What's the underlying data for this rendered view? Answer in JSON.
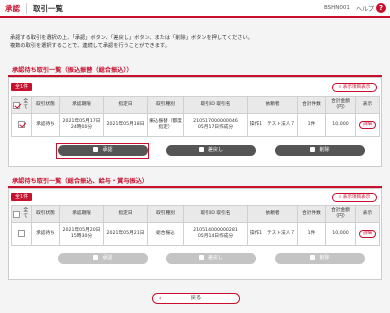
{
  "header": {
    "app": "承認",
    "title": "取引一覧",
    "screen_code": "BSHN001",
    "help_label": "ヘルプ",
    "help_icon": "?"
  },
  "instructions": {
    "line1": "承認する取引を選択の上、「承認」ボタン、「差戻し」ボタン、または「削除」ボタンを押してください。",
    "line2": "複数の取引を選択することで、連続して承認を行うことができます。"
  },
  "section1": {
    "title": "承認待ち取引一覧（振込振替（総合振込））",
    "count": "全1件",
    "detail_link": "表示項目表示",
    "columns": {
      "all": "全て",
      "status": "取引状態",
      "applied": "承認期限",
      "date": "指定日",
      "type": "取引種別",
      "id": "取引ID 取引名",
      "requester": "依頼者",
      "count": "合計件数",
      "amount": "合計金額（円）",
      "view": "表示"
    },
    "row": {
      "status": "承認待ち",
      "applied": "2021年05月17日 24時00分",
      "date": "2021年05月18日",
      "type": "振込振替（都度指定）",
      "id": "210517000000046",
      "name": "05月17日作成分",
      "requester": "操作1　テスト法人７",
      "count": "1件",
      "amount": "10,000",
      "view": "詳細"
    },
    "buttons": {
      "approve": "承認",
      "return": "差戻し",
      "delete": "削除"
    }
  },
  "section2": {
    "title": "承認待ち取引一覧（総合振込、給与・賞与振込）",
    "count": "全1件",
    "detail_link": "表示項目表示",
    "columns": {
      "all": "全て",
      "status": "取引状態",
      "applied": "承認期限",
      "date": "指定日",
      "type": "取引種別",
      "id": "取引ID 取引名",
      "requester": "依頼者",
      "count": "合計件数",
      "amount": "合計金額（円）",
      "view": "表示"
    },
    "row": {
      "status": "承認待ち",
      "applied": "2021年05月20日 15時30分",
      "date": "2021年05月21日",
      "type": "総合振込",
      "id": "210514000000281",
      "name": "05月14日作成分",
      "requester": "操作1　テスト法人７",
      "count": "1件",
      "amount": "10,000",
      "view": "詳細"
    },
    "buttons": {
      "approve": "承認",
      "return": "差戻し",
      "delete": "削除"
    }
  },
  "footer": {
    "back_label": "戻る"
  },
  "colors": {
    "accent": "#c8102e",
    "button_dark": "#555555",
    "button_disabled": "#c4c4c4"
  }
}
